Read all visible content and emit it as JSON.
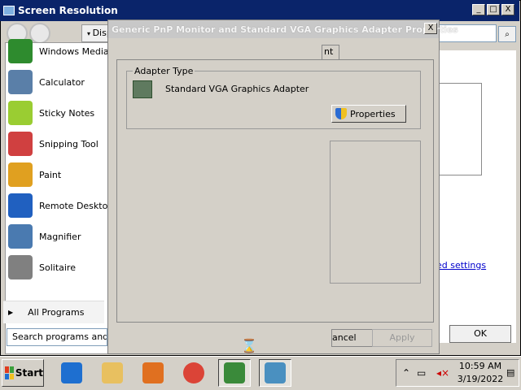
{
  "screen_resolution_window": {
    "title": "Screen Resolution",
    "title_buttons": {
      "minimize": "_",
      "maximize": "□",
      "close": "X"
    },
    "display_tab_label": "Disp",
    "advanced_settings_link": "ed settings",
    "ok_label": "OK"
  },
  "start_menu": {
    "items": [
      {
        "label": "Windows Media C",
        "icon": "windows-media-center-icon",
        "color": "#2e8b2e"
      },
      {
        "label": "Calculator",
        "icon": "calculator-icon",
        "color": "#5a7fa8"
      },
      {
        "label": "Sticky Notes",
        "icon": "sticky-notes-icon",
        "color": "#9acd32"
      },
      {
        "label": "Snipping Tool",
        "icon": "snipping-tool-icon",
        "color": "#d04040"
      },
      {
        "label": "Paint",
        "icon": "paint-icon",
        "color": "#e0a020"
      },
      {
        "label": "Remote Desktop",
        "icon": "remote-desktop-icon",
        "color": "#2060c0"
      },
      {
        "label": "Magnifier",
        "icon": "magnifier-icon",
        "color": "#4a7ab0"
      },
      {
        "label": "Solitaire",
        "icon": "solitaire-icon",
        "color": "#808080"
      }
    ],
    "all_programs_label": "All Programs",
    "search_placeholder": "Search programs and file"
  },
  "properties_dialog": {
    "title": "Generic PnP Monitor and Standard VGA Graphics Adapter Properties",
    "close_label": "X",
    "tab_label": "nt",
    "adapter_group_label": "Adapter Type",
    "adapter_name": "Standard VGA Graphics Adapter",
    "properties_button": "Properties",
    "cancel_label": "ancel",
    "apply_label": "Apply"
  },
  "taskbar": {
    "start_label": "Start",
    "apps": [
      {
        "name": "internet-explorer-icon",
        "color": "#1e6fd0"
      },
      {
        "name": "file-explorer-icon",
        "color": "#e8c060"
      },
      {
        "name": "media-player-icon",
        "color": "#e07020"
      },
      {
        "name": "chrome-icon",
        "color": "#db4437"
      },
      {
        "name": "control-panel-icon",
        "color": "#3a8a3a"
      },
      {
        "name": "screen-resolution-icon",
        "color": "#4a90c0"
      }
    ],
    "clock_time": "10:59 AM",
    "clock_date": "3/19/2022"
  }
}
